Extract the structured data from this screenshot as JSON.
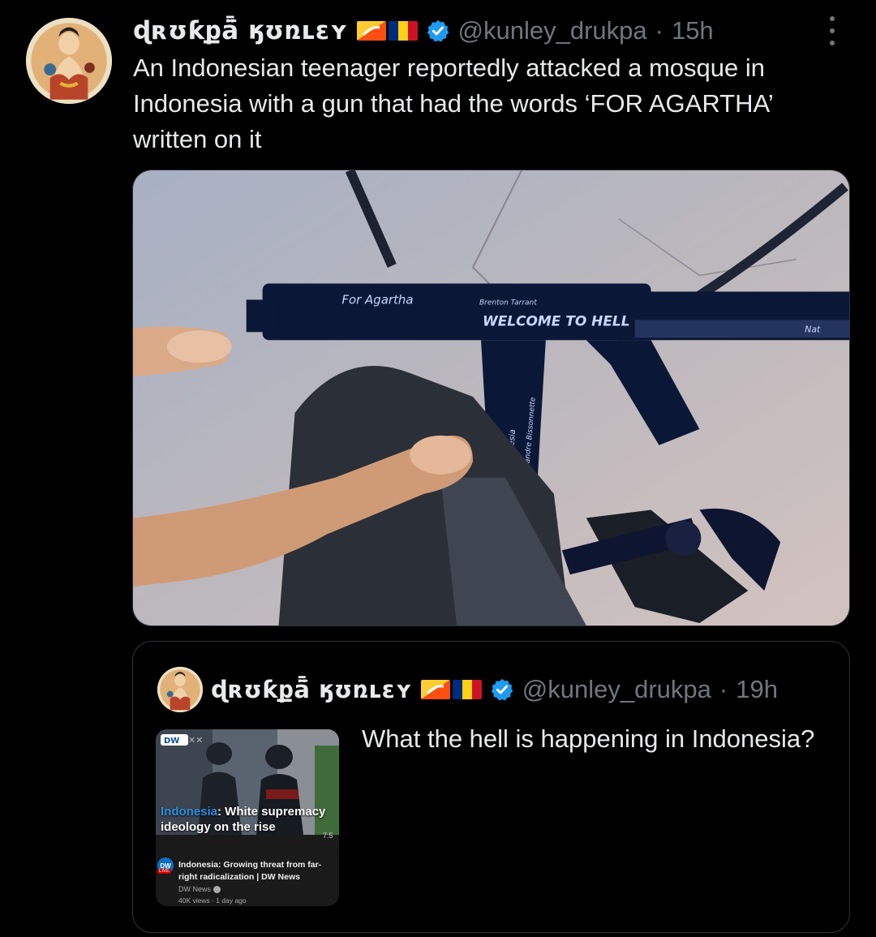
{
  "tweet": {
    "author": {
      "display_name": "ɖʀʊƙքǟ̄ ӄʊռʟɛʏ",
      "handle": "@kunley_drukpa",
      "verified": true,
      "flags": [
        "bhutan-flag",
        "romania-flag"
      ]
    },
    "separator": "·",
    "time": "15h",
    "text": "An Indonesian teenager reportedly attacked a mosque in Indonesia with a gun that had the words ‘FOR AGARTHA’ written on it",
    "media": {
      "type": "photo",
      "written_on_gun": [
        "For Agartha",
        "Brenton Tarrant",
        "WELCOME TO HELL",
        "Vico Tesia",
        "Alexandre Bissonnette",
        "Nat"
      ]
    }
  },
  "quoted_tweet": {
    "author": {
      "display_name": "ɖʀʊƙքǟ̄ ӄʊռʟɛʏ",
      "handle": "@kunley_drukpa",
      "verified": true
    },
    "separator": "·",
    "time": "19h",
    "text": "What the hell is happening in Indonesia?",
    "thumbnail": {
      "logo": "DW",
      "caption_highlight": "Indonesia",
      "caption_rest": ": White supremacy ideology on the rise",
      "duration": "7:5",
      "live_badge": "LIVE",
      "video_title": "Indonesia: Growing threat from far-right radicalization | DW News",
      "channel": "DW News",
      "meta": "40K views · 1 day ago"
    }
  },
  "colors": {
    "background": "#000000",
    "text_primary": "#e7e9ea",
    "text_secondary": "#71767b",
    "border": "#2f3336",
    "verified_blue": "#1d9bf0"
  }
}
